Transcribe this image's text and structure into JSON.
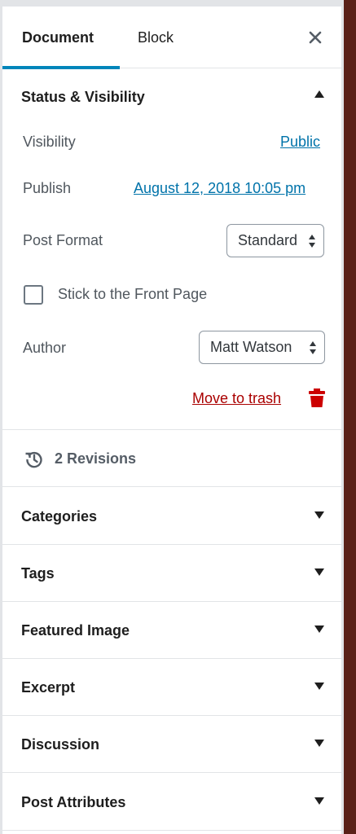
{
  "tabs": {
    "document": "Document",
    "block": "Block"
  },
  "status": {
    "title": "Status & Visibility",
    "visibility_label": "Visibility",
    "visibility_value": "Public",
    "publish_label": "Publish",
    "publish_value": "August 12, 2018 10:05 pm",
    "post_format_label": "Post Format",
    "post_format_value": "Standard",
    "sticky_label": "Stick to the Front Page",
    "sticky_checked": false,
    "author_label": "Author",
    "author_value": "Matt Watson",
    "trash_label": "Move to trash"
  },
  "revisions": {
    "label": "2 Revisions"
  },
  "panels": [
    "Categories",
    "Tags",
    "Featured Image",
    "Excerpt",
    "Discussion",
    "Post Attributes"
  ],
  "colors": {
    "accent": "#0085ba",
    "link": "#0073aa",
    "danger": "#a00",
    "backdrop": "#5a2118"
  },
  "icons": {
    "close": "close-icon",
    "caret_up": "caret-up-icon",
    "caret_down": "caret-down-icon",
    "trash": "trash-icon",
    "revisions": "history-icon"
  }
}
